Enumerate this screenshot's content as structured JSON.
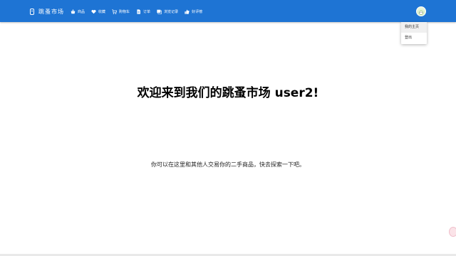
{
  "header": {
    "brand": "跳蚤市场",
    "nav": [
      {
        "label": "商品",
        "icon": "basket-icon"
      },
      {
        "label": "收藏",
        "icon": "heart-icon"
      },
      {
        "label": "购物车",
        "icon": "cart-icon"
      },
      {
        "label": "订单",
        "icon": "document-icon"
      },
      {
        "label": "浏览记录",
        "icon": "history-icon"
      },
      {
        "label": "好评榜",
        "icon": "thumbs-up-icon"
      }
    ],
    "accent": "#1e74d4"
  },
  "user_menu": {
    "items": [
      "我的主页",
      "登出"
    ]
  },
  "main": {
    "headline": "欢迎来到我们的跳蚤市场 user2!",
    "subline": "你可以在这里和其他人交易你的二手商品，快去探索一下吧。"
  }
}
